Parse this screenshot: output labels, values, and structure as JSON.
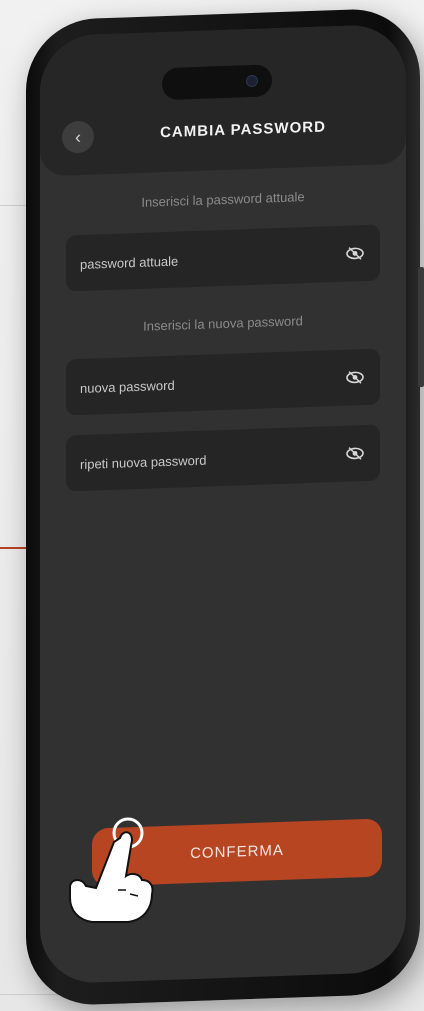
{
  "header": {
    "title": "CAMBIA PASSWORD",
    "back_icon": "chevron-left-icon"
  },
  "current": {
    "hint": "Inserisci la password attuale",
    "placeholder": "password attuale",
    "icon": "eye-icon"
  },
  "new": {
    "hint": "Inserisci la nuova password",
    "placeholder": "nuova password",
    "icon": "eye-icon"
  },
  "repeat": {
    "placeholder": "ripeti nuova password",
    "icon": "eye-icon"
  },
  "confirm": {
    "label": "CONFERMA"
  },
  "colors": {
    "accent": "#b74522",
    "screen_bg": "#313131",
    "field_bg": "#252525"
  }
}
